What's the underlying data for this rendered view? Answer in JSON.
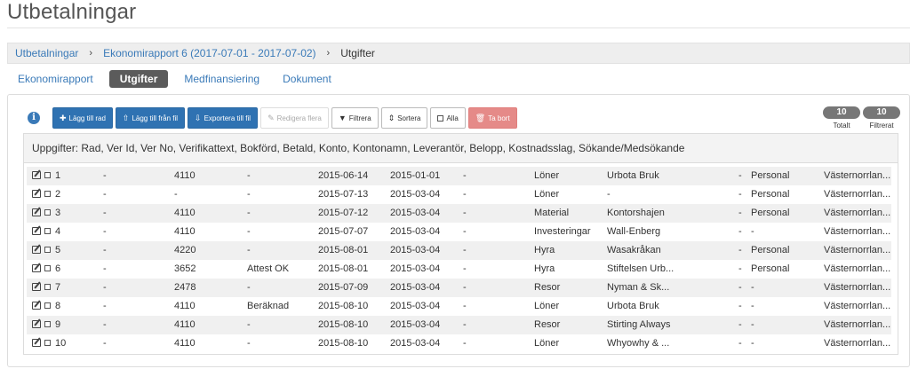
{
  "page": {
    "title": "Utbetalningar"
  },
  "breadcrumb": {
    "items": [
      "Utbetalningar",
      "Ekonomirapport 6 (2017-07-01 - 2017-07-02)"
    ],
    "current": "Utgifter",
    "separator": "›"
  },
  "tabs": [
    "Ekonomirapport",
    "Utgifter",
    "Medfinansiering",
    "Dokument"
  ],
  "toolbar": {
    "info_icon": "i",
    "add_row": "Lägg till rad",
    "add_from_file": "Lägg till från fil",
    "export_to_file": "Exportera till fil",
    "edit_multiple": "Redigera flera",
    "filter": "Filtrera",
    "sort": "Sortera",
    "all": "Alla",
    "delete": "Ta bort"
  },
  "counts": {
    "total_value": "10",
    "total_label": "Totalt",
    "filtered_value": "10",
    "filtered_label": "Filtrerat"
  },
  "table": {
    "header": "Uppgifter: Rad, Ver Id, Ver No, Verifikattext, Bokförd, Betald, Konto, Kontonamn, Leverantör, Belopp, Kostnadsslag, Sökande/Medsökande",
    "rows": [
      [
        "1",
        "-",
        "4110",
        "-",
        "2015-06-14",
        "2015-01-01",
        "-",
        "Löner",
        "Urbota Bruk",
        "-",
        "Personal",
        "Västernorrlan..."
      ],
      [
        "2",
        "-",
        "-",
        "-",
        "2015-07-13",
        "2015-03-04",
        "-",
        "Löner",
        "-",
        "-",
        "Personal",
        "Västernorrlan..."
      ],
      [
        "3",
        "-",
        "4110",
        "-",
        "2015-07-12",
        "2015-03-04",
        "-",
        "Material",
        "Kontorshajen",
        "-",
        "Personal",
        "Västernorrlan..."
      ],
      [
        "4",
        "-",
        "4110",
        "-",
        "2015-07-07",
        "2015-03-04",
        "-",
        "Investeringar",
        "Wall-Enberg",
        "-",
        "-",
        "Västernorrlan..."
      ],
      [
        "5",
        "-",
        "4220",
        "-",
        "2015-08-01",
        "2015-03-04",
        "-",
        "Hyra",
        "Wasakråkan",
        "-",
        "Personal",
        "Västernorrlan..."
      ],
      [
        "6",
        "-",
        "3652",
        "Attest OK",
        "2015-08-01",
        "2015-03-04",
        "-",
        "Hyra",
        "Stiftelsen Urb...",
        "-",
        "Personal",
        "Västernorrlan..."
      ],
      [
        "7",
        "-",
        "2478",
        "-",
        "2015-07-09",
        "2015-03-04",
        "-",
        "Resor",
        "Nyman & Sk...",
        "-",
        "-",
        "Västernorrlan..."
      ],
      [
        "8",
        "-",
        "4110",
        "Beräknad",
        "2015-08-10",
        "2015-03-04",
        "-",
        "Löner",
        "Urbota Bruk",
        "-",
        "-",
        "Västernorrlan..."
      ],
      [
        "9",
        "-",
        "4110",
        "-",
        "2015-08-10",
        "2015-03-04",
        "-",
        "Resor",
        "Stirting Always",
        "-",
        "-",
        "Västernorrlan..."
      ],
      [
        "10",
        "-",
        "4110",
        "-",
        "2015-08-10",
        "2015-03-04",
        "-",
        "Löner",
        "Whyowhy & ...",
        "-",
        "-",
        "Västernorrlan..."
      ]
    ]
  }
}
